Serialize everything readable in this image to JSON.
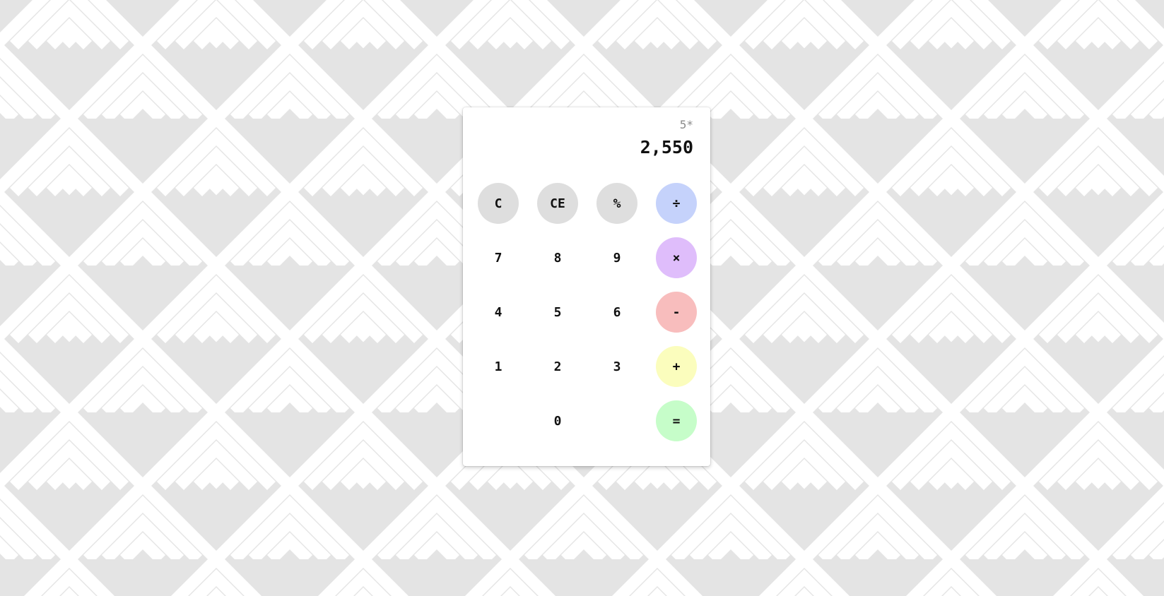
{
  "display": {
    "expression": "5*",
    "result": "2,550"
  },
  "keys": {
    "clear": "C",
    "clear_entry": "CE",
    "percent": "%",
    "divide": "÷",
    "seven": "7",
    "eight": "8",
    "nine": "9",
    "multiply": "×",
    "four": "4",
    "five": "5",
    "six": "6",
    "subtract": "-",
    "one": "1",
    "two": "2",
    "three": "3",
    "add": "+",
    "zero": "0",
    "equals": "="
  },
  "colors": {
    "func_key": "#dedede",
    "divide": "#c5d2fb",
    "multiply": "#dfbdfb",
    "subtract": "#f8bdbd",
    "add": "#fbfdbd",
    "equals": "#c6fdc9",
    "background_stripe": "#e2e2e2",
    "background_light": "#ffffff"
  }
}
